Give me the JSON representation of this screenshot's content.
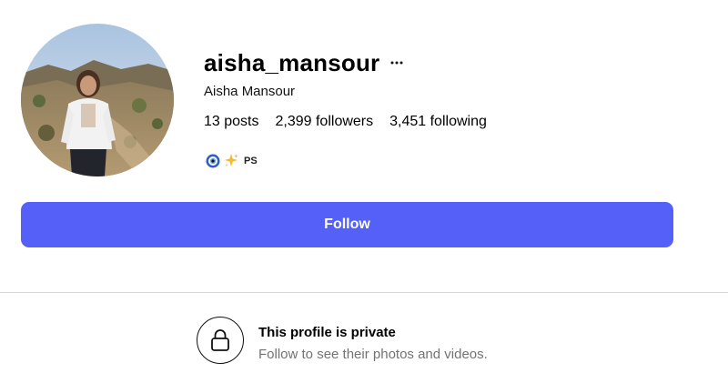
{
  "profile": {
    "username": "aisha_mansour",
    "full_name": "Aisha Mansour",
    "avatar_alt": "profile-photo"
  },
  "stats": {
    "posts_count": "13",
    "posts_label": "posts",
    "followers_count": "2,399",
    "followers_label": "followers",
    "following_count": "3,451",
    "following_label": "following"
  },
  "bio": {
    "emojis": [
      "nazar-amulet-icon",
      "sparkles-icon"
    ],
    "text": "PS"
  },
  "actions": {
    "follow_label": "Follow",
    "more_icon": "more-options-icon"
  },
  "private_notice": {
    "title": "This profile is private",
    "subtitle": "Follow to see their photos and videos.",
    "icon": "lock-icon"
  },
  "colors": {
    "accent": "#5460f7",
    "divider": "#d6d6d6",
    "secondary_text": "#737373"
  }
}
